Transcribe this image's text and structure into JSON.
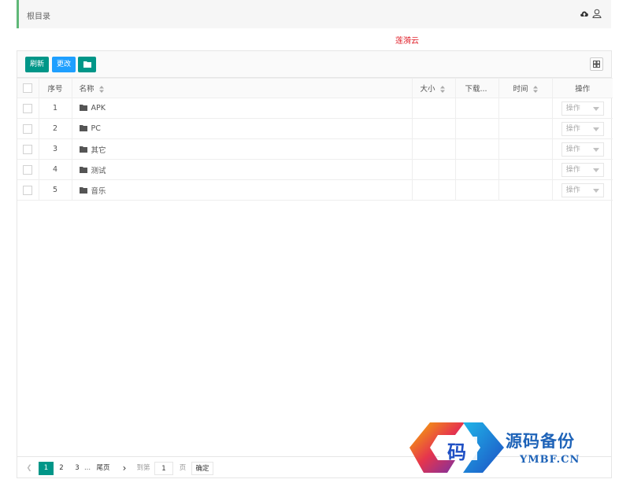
{
  "breadcrumb": {
    "label": "根目录"
  },
  "header_icons": [
    "cloud-upload-icon",
    "user-icon"
  ],
  "brand": {
    "text": "莲漪云",
    "color": "#e0202a"
  },
  "toolbar": {
    "refresh_label": "刷新",
    "change_label": "更改",
    "folder_icon": "folder-icon",
    "columns_icon": "columns-icon"
  },
  "table": {
    "headers": {
      "index": "序号",
      "name": "名称",
      "size": "大小",
      "downloads": "下载...",
      "time": "时间",
      "actions": "操作"
    },
    "rows": [
      {
        "index": "1",
        "name": "APK",
        "size": "",
        "downloads": "",
        "time": "",
        "action": "操作"
      },
      {
        "index": "2",
        "name": "PC",
        "size": "",
        "downloads": "",
        "time": "",
        "action": "操作"
      },
      {
        "index": "3",
        "name": "其它",
        "size": "",
        "downloads": "",
        "time": "",
        "action": "操作"
      },
      {
        "index": "4",
        "name": "测试",
        "size": "",
        "downloads": "",
        "time": "",
        "action": "操作"
      },
      {
        "index": "5",
        "name": "音乐",
        "size": "",
        "downloads": "",
        "time": "",
        "action": "操作"
      }
    ]
  },
  "pagination": {
    "pages": [
      "1",
      "2",
      "3"
    ],
    "current": "1",
    "ellipsis": "...",
    "last_label": "尾页",
    "goto_label": "到第",
    "goto_value": "1",
    "unit_label": "页",
    "confirm_label": "确定"
  },
  "watermark": {
    "title": "源码备份",
    "subtitle": "YMBF.CN",
    "logo_char": "码"
  },
  "colors": {
    "accent": "#009688",
    "blue": "#1e9fff",
    "green_border": "#5fb878"
  }
}
